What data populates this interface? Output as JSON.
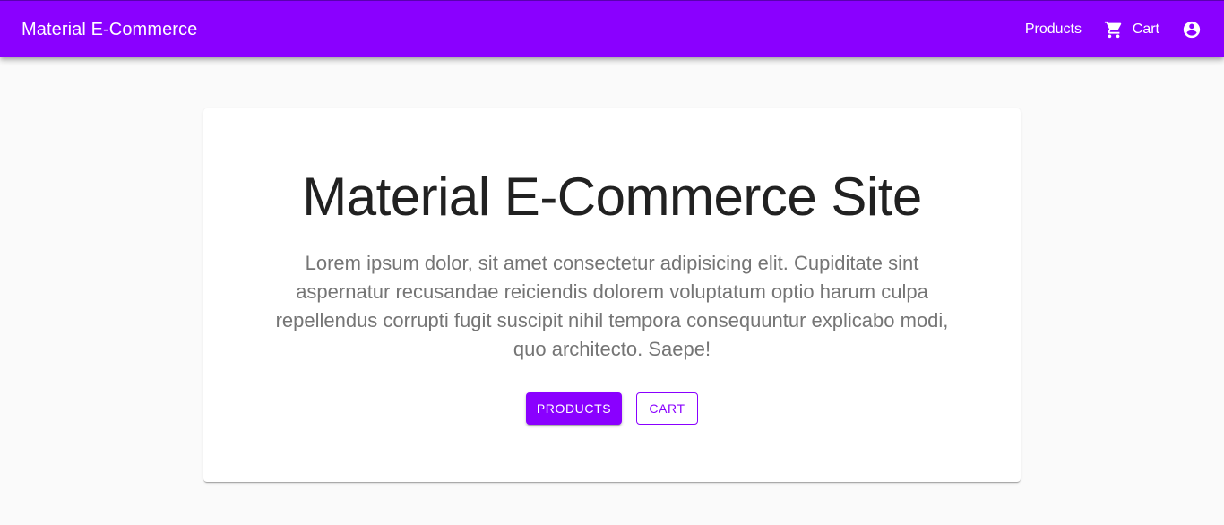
{
  "appbar": {
    "brand": "Material E-Commerce",
    "nav": {
      "products_label": "Products",
      "cart_label": "Cart",
      "cart_icon": "shopping-cart-icon",
      "account_icon": "account-circle-icon"
    }
  },
  "hero": {
    "title": "Material E-Commerce Site",
    "text": "Lorem ipsum dolor, sit amet consectetur adipisicing elit. Cupiditate sint aspernatur recusandae reiciendis dolorem voluptatum optio harum culpa repellendus corrupti fugit suscipit nihil tempora consequuntur explicabo modi, quo architecto. Saepe!",
    "primary_button": "Products",
    "secondary_button": "Cart"
  },
  "colors": {
    "primary": "#8a00ff",
    "background": "#fafafa",
    "card": "#ffffff",
    "title_text": "#212121",
    "body_text": "#757575"
  }
}
